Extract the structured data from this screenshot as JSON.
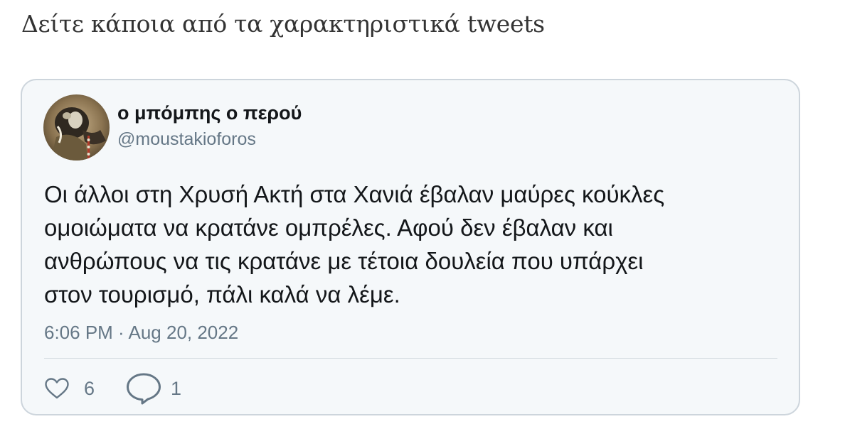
{
  "article": {
    "heading": "Δείτε κάποια από τα χαρακτηριστικά tweets"
  },
  "tweet": {
    "display_name": "ο μπόμπης ο περού",
    "handle": "@moustakioforos",
    "text_lines": [
      "Οι άλλοι στη Χρυσή Ακτή στα Χανιά έβαλαν μαύρες κούκλες",
      "ομοιώματα να κρατάνε ομπρέλες. Αφού δεν έβαλαν και",
      "ανθρώπους να τις κρατάνε με τέτοια δουλεία που υπάρχει",
      "στον τουρισμό, πάλι καλά να λέμε."
    ],
    "timestamp": "6:06 PM · Aug 20, 2022",
    "likes": "6",
    "replies": "1",
    "icons": {
      "like": "heart-icon",
      "reply": "speech-bubble-icon"
    },
    "colors": {
      "card_background": "#f5f8fa",
      "card_border": "#cdd5dc",
      "muted_text": "#657786",
      "primary_text": "#14171a"
    }
  }
}
